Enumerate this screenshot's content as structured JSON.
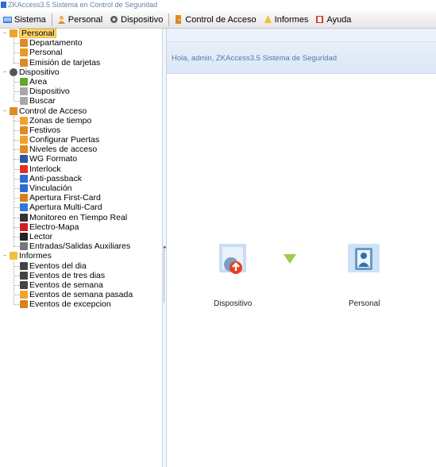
{
  "window": {
    "title": "ZKAccess3.5 Sistema en Control de Seguridad"
  },
  "menu": [
    {
      "label": "Sistema",
      "icon": "system-icon"
    },
    {
      "label": "Personal",
      "icon": "person-icon"
    },
    {
      "label": "Dispositivo",
      "icon": "gear-icon"
    },
    {
      "label": "Control de Acceso",
      "icon": "door-icon"
    },
    {
      "label": "Informes",
      "icon": "report-icon"
    },
    {
      "label": "Ayuda",
      "icon": "help-icon"
    }
  ],
  "tree": {
    "personal": {
      "label": "Personal",
      "children": [
        "Departamento",
        "Personal",
        "Emisión de tarjetas"
      ]
    },
    "dispositivo": {
      "label": "Dispositivo",
      "children": [
        "Area",
        "Dispositivo",
        "Buscar"
      ]
    },
    "control": {
      "label": "Control de Acceso",
      "children": [
        "Zonas de tiempo",
        "Festivos",
        "Configurar Puertas",
        "Niveles de acceso",
        "WG Formato",
        "Interlock",
        "Anti-passback",
        "Vinculación",
        "Apertura First-Card",
        "Apertura Multi-Card",
        "Monitoreo en Tiempo Real",
        "Electro-Mapa",
        "Lector",
        "Entradas/Salidas Auxiliares"
      ]
    },
    "informes": {
      "label": "Informes",
      "children": [
        "Eventos del dia",
        "Eventos de tres dias",
        "Eventos de semana",
        "Eventos de semana pasada",
        "Eventos de excepcion"
      ]
    }
  },
  "main": {
    "welcome": "Hola, admin,  ZKAccess3.5 Sistema de Seguridad",
    "flow": [
      {
        "label": "Dispositivo",
        "icon": "device-icon"
      },
      {
        "label": "Personal",
        "icon": "personal-card-icon"
      }
    ]
  },
  "colors": {
    "accent": "#2f6bd6",
    "selection": "#ffd76b",
    "welcome_text": "#5577aa"
  }
}
